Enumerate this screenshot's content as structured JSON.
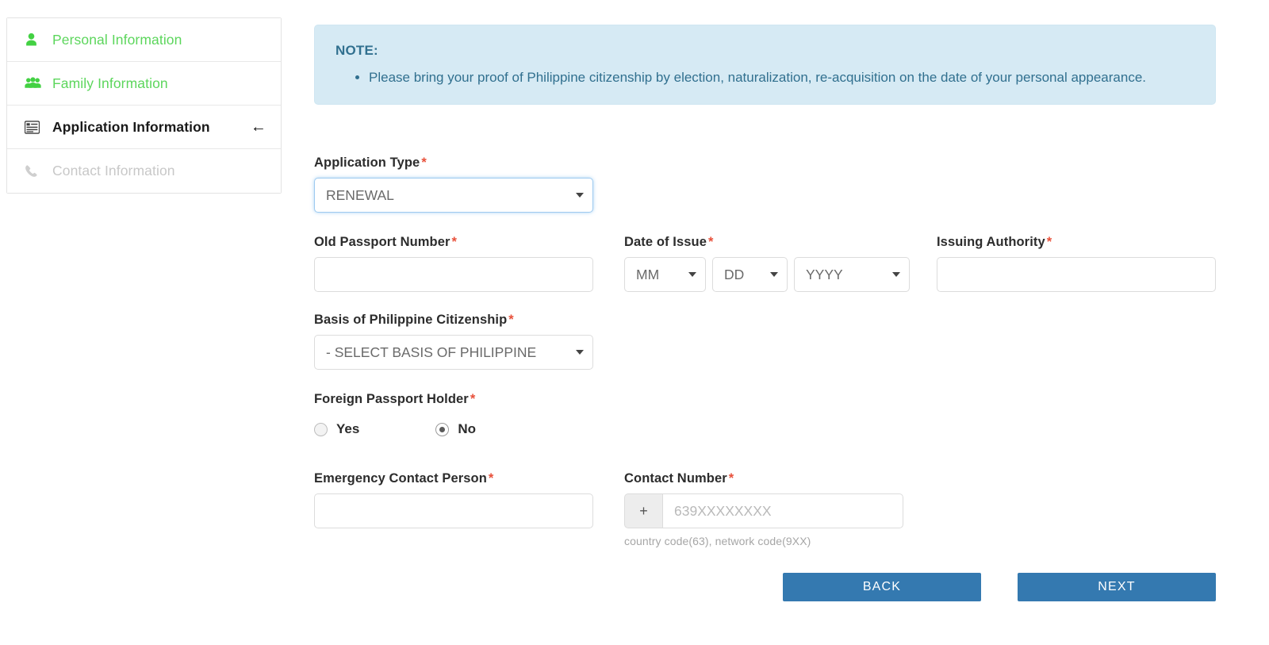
{
  "sidebar": {
    "items": [
      {
        "label": "Personal Information",
        "icon": "user-icon",
        "state": "done"
      },
      {
        "label": "Family Information",
        "icon": "users-icon",
        "state": "done"
      },
      {
        "label": "Application Information",
        "icon": "list-alt-icon",
        "state": "active",
        "arrow": "←"
      },
      {
        "label": "Contact Information",
        "icon": "phone-icon",
        "state": "disabled"
      }
    ]
  },
  "note": {
    "title": "NOTE:",
    "items": [
      "Please bring your proof of Philippine citizenship by election, naturalization, re-acquisition on the date of your personal appearance."
    ]
  },
  "form": {
    "application_type": {
      "label": "Application Type",
      "required": "*",
      "value": "RENEWAL"
    },
    "old_passport_number": {
      "label": "Old Passport Number",
      "required": "*",
      "value": "",
      "placeholder": ""
    },
    "date_of_issue": {
      "label": "Date of Issue",
      "required": "*",
      "month": "MM",
      "day": "DD",
      "year": "YYYY"
    },
    "issuing_authority": {
      "label": "Issuing Authority",
      "required": "*",
      "value": "",
      "placeholder": ""
    },
    "basis_of_citizenship": {
      "label": "Basis of Philippine Citizenship",
      "required": "*",
      "value": "- SELECT BASIS OF PHILIPPINE"
    },
    "foreign_passport_holder": {
      "label": "Foreign Passport Holder",
      "required": "*",
      "yes_label": "Yes",
      "no_label": "No",
      "selected": "No"
    },
    "emergency_contact_person": {
      "label": "Emergency Contact Person",
      "required": "*",
      "value": "",
      "placeholder": ""
    },
    "contact_number": {
      "label": "Contact Number",
      "required": "*",
      "prefix": "+",
      "value": "",
      "placeholder": "639XXXXXXXX",
      "help": "country code(63), network code(9XX)"
    }
  },
  "actions": {
    "back_label": "BACK",
    "next_label": "NEXT"
  },
  "colors": {
    "note_bg": "#d6eaf4",
    "note_text": "#31708f",
    "primary_button": "#3479b0",
    "required_star": "#e8503a",
    "done_green": "#5cd65c",
    "disabled_gray": "#c8c8c8"
  }
}
